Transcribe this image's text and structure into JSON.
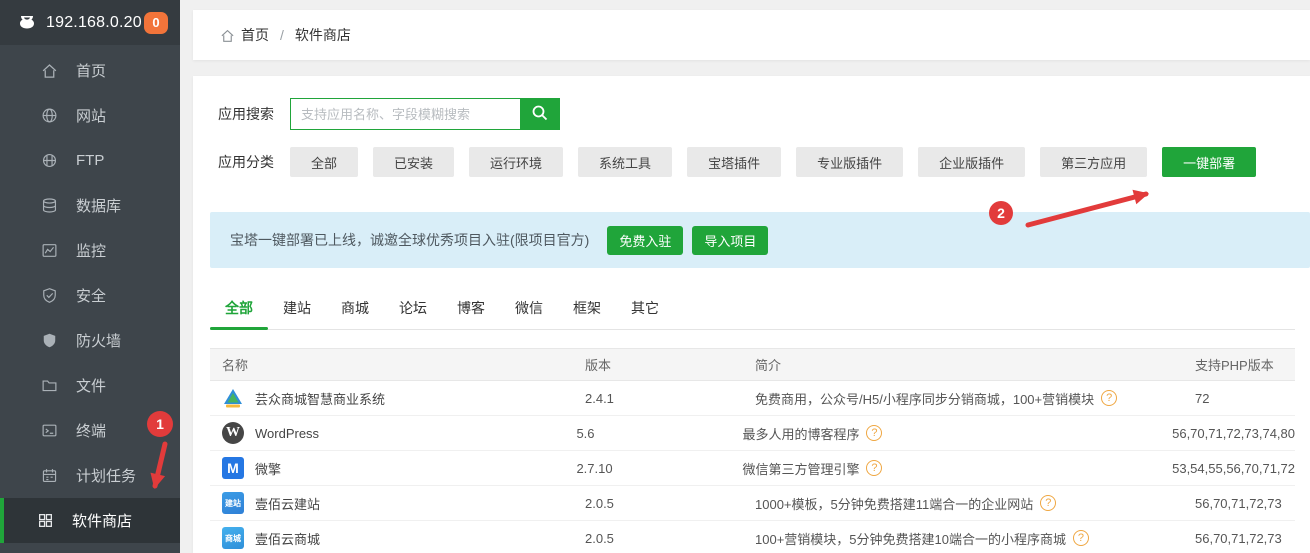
{
  "sidebar": {
    "server_ip": "192.168.0.20",
    "badge": "0",
    "items": [
      {
        "label": "首页"
      },
      {
        "label": "网站"
      },
      {
        "label": "FTP"
      },
      {
        "label": "数据库"
      },
      {
        "label": "监控"
      },
      {
        "label": "安全"
      },
      {
        "label": "防火墙"
      },
      {
        "label": "文件"
      },
      {
        "label": "终端"
      },
      {
        "label": "计划任务"
      },
      {
        "label": "软件商店"
      }
    ]
  },
  "breadcrumb": {
    "home": "首页",
    "separator": "/",
    "current": "软件商店"
  },
  "search": {
    "label": "应用搜索",
    "placeholder": "支持应用名称、字段模糊搜索"
  },
  "categories": {
    "label": "应用分类",
    "items": [
      "全部",
      "已安装",
      "运行环境",
      "系统工具",
      "宝塔插件",
      "专业版插件",
      "企业版插件",
      "第三方应用"
    ],
    "deploy": "一键部署"
  },
  "notice": {
    "text": "宝塔一键部署已上线，诚邀全球优秀项目入驻(限项目官方)",
    "buttons": [
      "免费入驻",
      "导入项目"
    ]
  },
  "tabs": [
    "全部",
    "建站",
    "商城",
    "论坛",
    "博客",
    "微信",
    "框架",
    "其它"
  ],
  "table": {
    "headers": [
      "名称",
      "版本",
      "简介",
      "支持PHP版本"
    ],
    "rows": [
      {
        "name": "芸众商城智慧商业系统",
        "logo_text": "",
        "version": "2.4.1",
        "desc": "免费商用，公众号/H5/小程序同步分销商城，100+营销模块",
        "php": "72"
      },
      {
        "name": "WordPress",
        "logo_text": "W",
        "version": "5.6",
        "desc": "最多人用的博客程序",
        "php": "56,70,71,72,73,74,80"
      },
      {
        "name": "微擎",
        "logo_text": "M",
        "version": "2.7.10",
        "desc": "微信第三方管理引擎",
        "php": "53,54,55,56,70,71,72"
      },
      {
        "name": "壹佰云建站",
        "logo_text": "建站",
        "version": "2.0.5",
        "desc": "1000+模板，5分钟免费搭建11端合一的企业网站",
        "php": "56,70,71,72,73"
      },
      {
        "name": "壹佰云商城",
        "logo_text": "商城",
        "version": "2.0.5",
        "desc": "100+营销模块，5分钟免费搭建10端合一的小程序商城",
        "php": "56,70,71,72,73"
      }
    ],
    "help_glyph": "?"
  },
  "annotations": {
    "step1": "1",
    "step2": "2"
  },
  "colors": {
    "accent_green": "#20a53a",
    "badge_orange": "#f2743a",
    "annotation_red": "#e23b3b",
    "notice_blue_bg": "#d9eef8",
    "sidebar_bg": "#3e454b"
  }
}
